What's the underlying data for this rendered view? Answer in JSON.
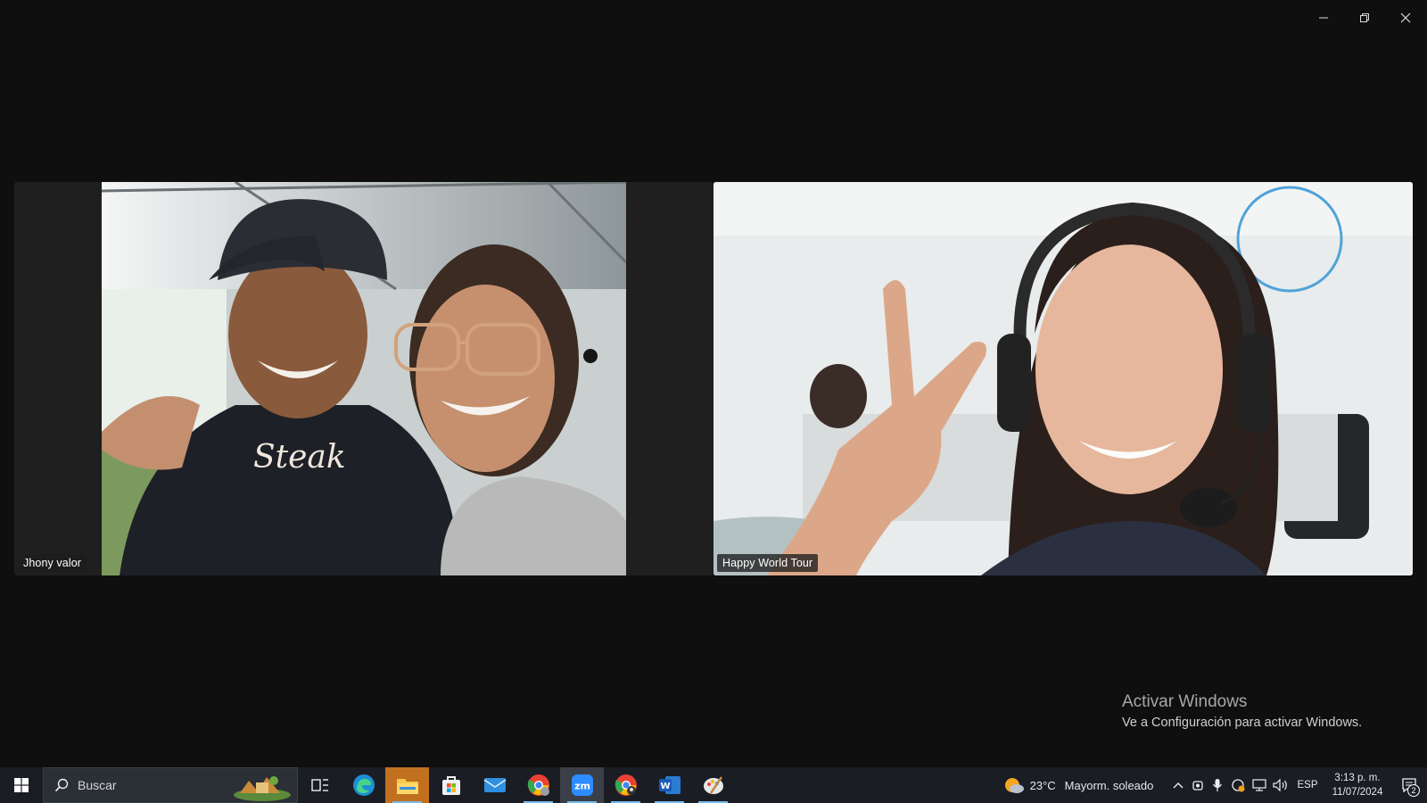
{
  "meeting": {
    "participants": [
      {
        "name": "Jhony valor"
      },
      {
        "name": "Happy World Tour"
      }
    ]
  },
  "watermark": {
    "title": "Activar Windows",
    "subtitle": "Ve a Configuración para activar Windows."
  },
  "taskbar": {
    "search_placeholder": "Buscar",
    "apps": [
      "task-view",
      "edge",
      "file-explorer",
      "microsoft-store",
      "mail",
      "chrome-profile",
      "zoom",
      "chrome",
      "word",
      "paint"
    ],
    "weather": {
      "temp": "23°C",
      "condition": "Mayorm. soleado"
    },
    "language": "ESP",
    "time": "3:13 p. m.",
    "date": "11/07/2024",
    "notification_count": "2"
  },
  "colors": {
    "background": "#0f0f10",
    "tile": "#1f1f1f",
    "taskbar": "#1a1d24",
    "accent": "#76b9ed"
  }
}
